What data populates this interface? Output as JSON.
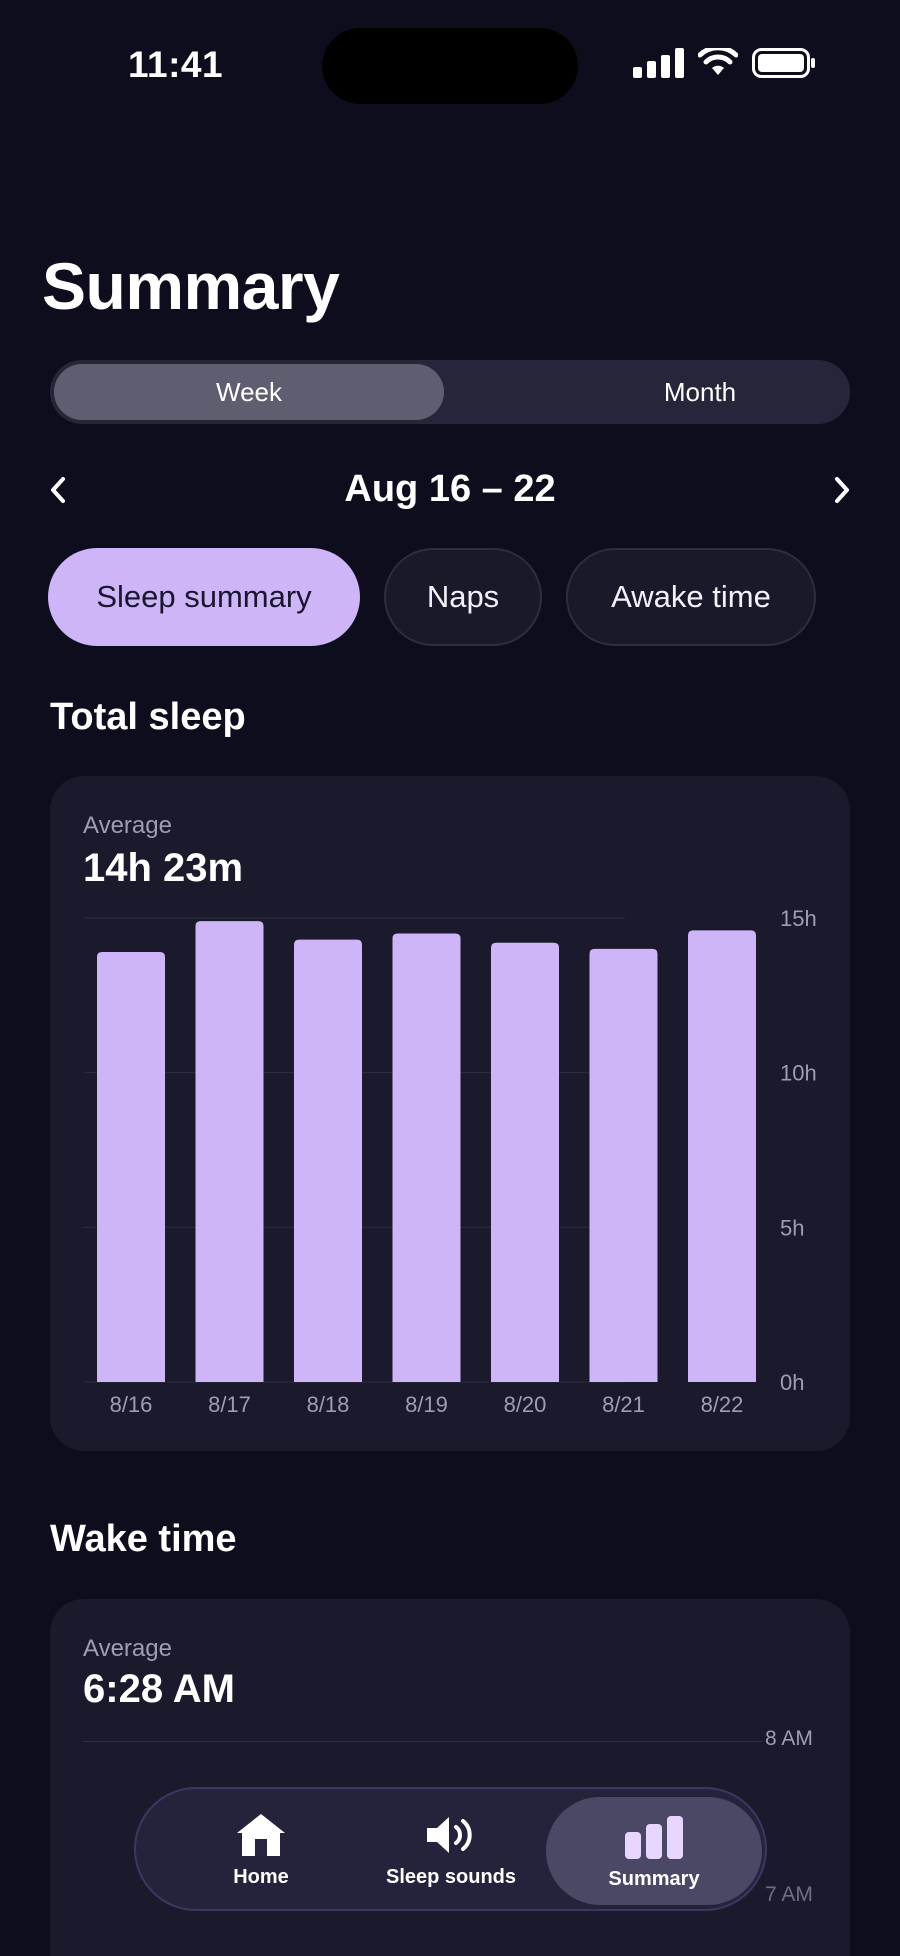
{
  "status": {
    "time": "11:41"
  },
  "header": {
    "title": "Summary"
  },
  "segment": {
    "options": [
      "Week",
      "Month"
    ],
    "selected": "Week"
  },
  "date_nav": {
    "label": "Aug 16 – 22"
  },
  "chips": [
    "Sleep summary",
    "Naps",
    "Awake time"
  ],
  "total_sleep": {
    "section_title": "Total sleep",
    "avg_label": "Average",
    "avg_value": "14h 23m",
    "chart_data": {
      "type": "bar",
      "categories": [
        "8/16",
        "8/17",
        "8/18",
        "8/19",
        "8/20",
        "8/21",
        "8/22"
      ],
      "values": [
        13.9,
        14.9,
        14.3,
        14.5,
        14.2,
        14.0,
        14.6
      ],
      "ylim": [
        0,
        15
      ],
      "yticks": [
        0,
        5,
        10,
        15
      ],
      "ytick_labels": [
        "0h",
        "5h",
        "10h",
        "15h"
      ],
      "grid": true,
      "bar_color": "#cdb5f7"
    }
  },
  "wake_time": {
    "section_title": "Wake time",
    "avg_label": "Average",
    "avg_value": "6:28 AM",
    "axis_labels": [
      "8 AM",
      "7 AM"
    ]
  },
  "tab_bar": {
    "items": [
      {
        "label": "Home",
        "icon": "home-icon"
      },
      {
        "label": "Sleep sounds",
        "icon": "speaker-icon"
      },
      {
        "label": "Summary",
        "icon": "bar-chart-icon"
      }
    ],
    "active": "Summary"
  },
  "colors": {
    "background": "#0e0d1d",
    "card": "#1b1a2c",
    "accent": "#cdb5f7"
  }
}
